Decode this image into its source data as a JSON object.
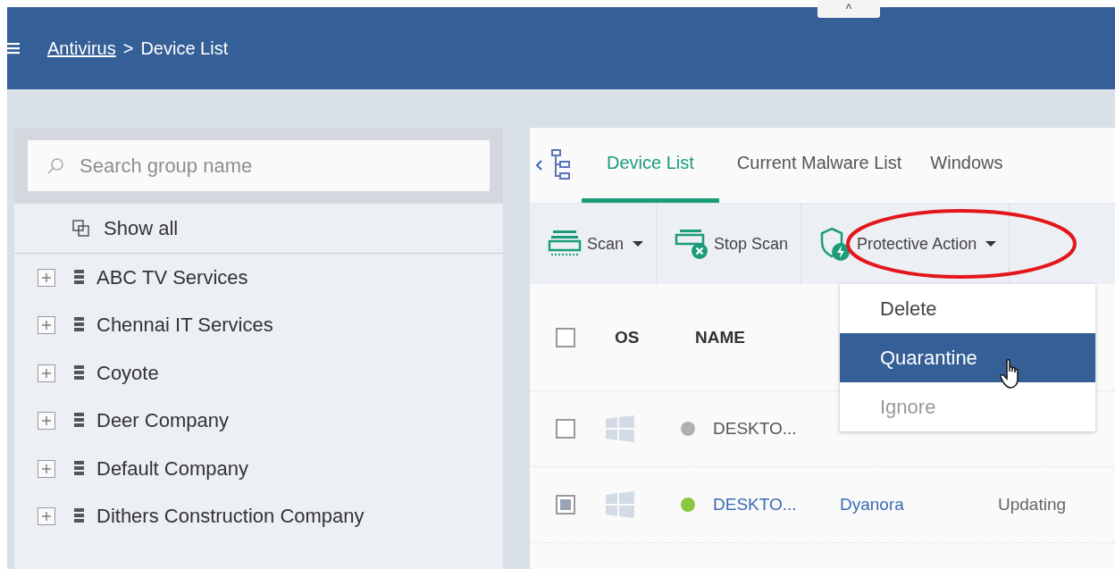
{
  "header": {
    "collapse_tab": "^",
    "breadcrumb": {
      "link": "Antivirus",
      "separator": ">",
      "current": "Device List"
    }
  },
  "sidebar": {
    "search": {
      "placeholder": "Search group name"
    },
    "show_all": "Show all",
    "groups": [
      {
        "name": "ABC TV Services",
        "expanded": false
      },
      {
        "name": "Chennai IT Services",
        "expanded": false
      },
      {
        "name": "Coyote",
        "expanded": false
      },
      {
        "name": "Deer Company",
        "expanded": false
      },
      {
        "name": "Default Company",
        "expanded": false
      },
      {
        "name": "Dithers Construction Company",
        "expanded": false
      }
    ]
  },
  "tabs": [
    {
      "label": "Device List",
      "selected": true
    },
    {
      "label": "Current Malware List",
      "selected": false
    },
    {
      "label": "Windows",
      "selected": false
    }
  ],
  "toolbar": [
    {
      "kind": "scan",
      "label": "Scan",
      "dropdown": true
    },
    {
      "kind": "stop",
      "label": "Stop Scan",
      "dropdown": false
    },
    {
      "kind": "protect",
      "label": "Protective Action",
      "dropdown": true,
      "highlighted": true
    }
  ],
  "menu": [
    {
      "label": "Delete",
      "selected": false,
      "disabled": false
    },
    {
      "label": "Quarantine",
      "selected": true,
      "disabled": false
    },
    {
      "label": "Ignore",
      "selected": false,
      "disabled": true
    }
  ],
  "table": {
    "select_all": false,
    "columns": [
      "OS",
      "NAME"
    ],
    "rows": [
      {
        "checked": false,
        "color": "#b0b0b0",
        "online": false,
        "name": "DESKTO..."
      },
      {
        "checked": true,
        "color": "#8cc63f",
        "online": true,
        "name": "DESKTO...",
        "user": "Dyanora",
        "status": "Updating"
      }
    ]
  }
}
